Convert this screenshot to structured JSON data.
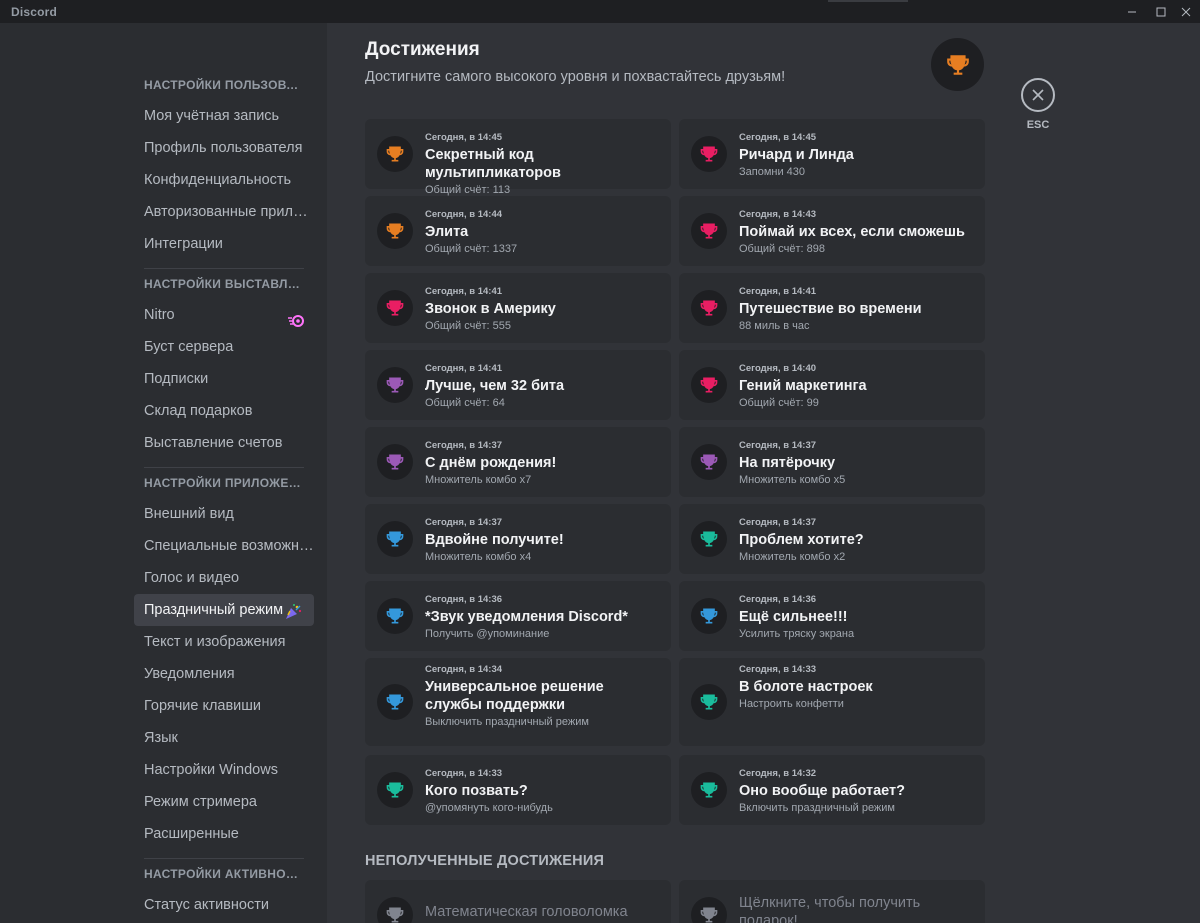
{
  "window": {
    "app_name": "Discord",
    "controls": [
      "minimize-icon",
      "maximize-icon",
      "close-icon"
    ]
  },
  "sidebar": {
    "sections": [
      {
        "header": "НАСТРОЙКИ ПОЛЬЗОВАТЕЛЯ",
        "items": [
          "Моя учётная запись",
          "Профиль пользователя",
          "Конфиденциальность",
          "Авторизованные приложения",
          "Интеграции"
        ]
      },
      {
        "header": "НАСТРОЙКИ ВЫСТАВЛЕНИЯ СЧЕТОВ",
        "items": [
          "Nitro",
          "Буст сервера",
          "Подписки",
          "Склад подарков",
          "Выставление счетов"
        ]
      },
      {
        "header": "НАСТРОЙКИ ПРИЛОЖЕНИЯ",
        "items": [
          "Внешний вид",
          "Специальные возможности",
          "Голос и видео",
          "Праздничный режим",
          "Текст и изображения",
          "Уведомления",
          "Горячие клавиши",
          "Язык",
          "Настройки Windows",
          "Режим стримера",
          "Расширенные"
        ]
      },
      {
        "header": "НАСТРОЙКИ АКТИВНОСТИ",
        "items": [
          "Статус активности"
        ]
      }
    ],
    "active_item": "Праздничный режим"
  },
  "main": {
    "title": "Достижения",
    "subtitle": "Достигните самого высокого уровня и похвастайтесь друзьям!",
    "esc_label": "ESC",
    "locked_header": "НЕПОЛУЧЕННЫЕ ДОСТИЖЕНИЯ",
    "achievements": [
      {
        "time": "Сегодня, в 14:45",
        "name": "Секретный код мультипликаторов",
        "desc": "Общий счёт: 113",
        "color": "#e67e22"
      },
      {
        "time": "Сегодня, в 14:45",
        "name": "Ричард и Линда",
        "desc": "Запомни 430",
        "color": "#e91e63"
      },
      {
        "time": "Сегодня, в 14:44",
        "name": "Элита",
        "desc": "Общий счёт: 1337",
        "color": "#e67e22"
      },
      {
        "time": "Сегодня, в 14:43",
        "name": "Поймай их всех, если сможешь",
        "desc": "Общий счёт: 898",
        "color": "#e91e63"
      },
      {
        "time": "Сегодня, в 14:41",
        "name": "Звонок в Америку",
        "desc": "Общий счёт: 555",
        "color": "#e91e63"
      },
      {
        "time": "Сегодня, в 14:41",
        "name": "Путешествие во времени",
        "desc": "88 миль в час",
        "color": "#e91e63"
      },
      {
        "time": "Сегодня, в 14:41",
        "name": "Лучше, чем 32 бита",
        "desc": "Общий счёт: 64",
        "color": "#9b59b6"
      },
      {
        "time": "Сегодня, в 14:40",
        "name": "Гений маркетинга",
        "desc": "Общий счёт: 99",
        "color": "#e91e63"
      },
      {
        "time": "Сегодня, в 14:37",
        "name": "С днём рождения!",
        "desc": "Множитель комбо x7",
        "color": "#9b59b6"
      },
      {
        "time": "Сегодня, в 14:37",
        "name": "На пятёрочку",
        "desc": "Множитель комбо x5",
        "color": "#9b59b6"
      },
      {
        "time": "Сегодня, в 14:37",
        "name": "Вдвойне получите!",
        "desc": "Множитель комбо x4",
        "color": "#3498db"
      },
      {
        "time": "Сегодня, в 14:37",
        "name": "Проблем хотите?",
        "desc": "Множитель комбо x2",
        "color": "#1abc9c"
      },
      {
        "time": "Сегодня, в 14:36",
        "name": "*Звук уведомления Discord*",
        "desc": "Получить @упоминание",
        "color": "#3498db"
      },
      {
        "time": "Сегодня, в 14:36",
        "name": "Ещё сильнее!!!",
        "desc": "Усилить тряску экрана",
        "color": "#3498db"
      },
      {
        "time": "Сегодня, в 14:34",
        "name": "Универсальное решение службы поддержки",
        "desc": "Выключить праздничный режим",
        "color": "#3498db"
      },
      {
        "time": "Сегодня, в 14:33",
        "name": "В болоте настроек",
        "desc": "Настроить конфетти",
        "color": "#1abc9c"
      },
      {
        "time": "Сегодня, в 14:33",
        "name": "Кого позвать?",
        "desc": "@упомянуть кого-нибудь",
        "color": "#1abc9c"
      },
      {
        "time": "Сегодня, в 14:32",
        "name": "Оно вообще работает?",
        "desc": "Включить праздничный режим",
        "color": "#1abc9c"
      }
    ],
    "locked": [
      {
        "name": "Математическая головоломка",
        "color": "#80848e"
      },
      {
        "name": "Щёлкните, чтобы получить подарок!",
        "color": "#80848e"
      }
    ]
  },
  "colors": {
    "accent_orange": "#e67e22",
    "nitro_pink": "#ff73fa"
  }
}
